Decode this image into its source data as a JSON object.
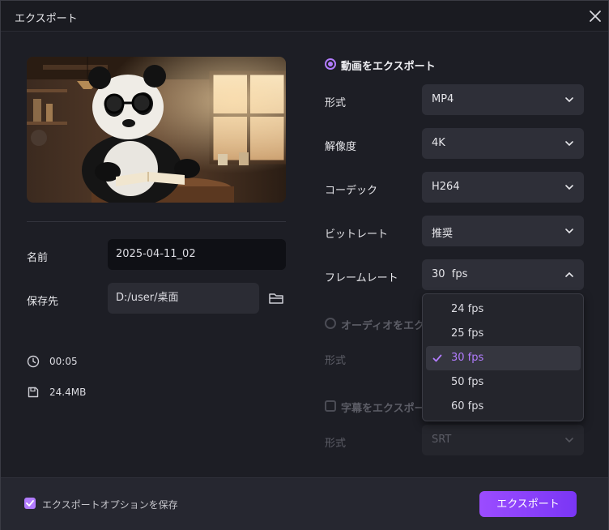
{
  "dialog": {
    "title": "エクスポート"
  },
  "left": {
    "name_label": "名前",
    "name_value": "2025-04-11_02",
    "path_label": "保存先",
    "path_value": "D:/user/桌面",
    "duration": "00:05",
    "filesize": "24.4MB"
  },
  "video": {
    "section_title": "動画をエクスポート",
    "format": {
      "label": "形式",
      "value": "MP4"
    },
    "resolution": {
      "label": "解像度",
      "value": "4K"
    },
    "codec": {
      "label": "コーデック",
      "value": "H264"
    },
    "bitrate": {
      "label": "ビットレート",
      "value": "推奨"
    },
    "framerate": {
      "label": "フレームレート",
      "value": "30  fps"
    }
  },
  "framerate_options": [
    {
      "label": "24 fps",
      "selected": false
    },
    {
      "label": "25 fps",
      "selected": false
    },
    {
      "label": "30 fps",
      "selected": true
    },
    {
      "label": "50 fps",
      "selected": false
    },
    {
      "label": "60 fps",
      "selected": false
    }
  ],
  "audio": {
    "section_title": "オーディオをエクス",
    "format_label": "形式"
  },
  "subtitle": {
    "section_title": "字幕をエクスポー",
    "format_label": "形式",
    "format_value": "SRT"
  },
  "footer": {
    "save_options_label": "エクスポートオプションを保存",
    "export_button": "エクスポート"
  },
  "colors": {
    "accent": "#b27cff",
    "button_start": "#9b4cff",
    "button_end": "#7a36f5"
  }
}
